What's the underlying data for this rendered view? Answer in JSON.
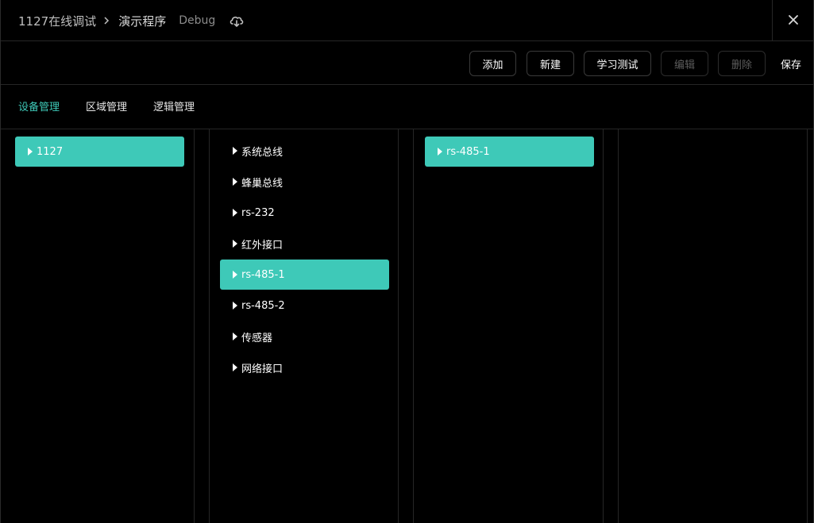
{
  "header": {
    "breadcrumb_root": "1127在线调试",
    "breadcrumb_current": "演示程序",
    "environment": "Debug"
  },
  "toolbar": {
    "add_label": "添加",
    "new_label": "新建",
    "learn_test_label": "学习测试",
    "edit_label": "编辑",
    "delete_label": "删除",
    "save_label": "保存"
  },
  "tabs": [
    {
      "label": "设备管理",
      "active": true
    },
    {
      "label": "区域管理",
      "active": false
    },
    {
      "label": "逻辑管理",
      "active": false
    }
  ],
  "column1": {
    "items": [
      {
        "label": "1127",
        "selected": true
      }
    ]
  },
  "column2": {
    "items": [
      {
        "label": "系统总线",
        "selected": false
      },
      {
        "label": "蜂巢总线",
        "selected": false
      },
      {
        "label": "rs-232",
        "selected": false
      },
      {
        "label": "红外接口",
        "selected": false
      },
      {
        "label": "rs-485-1",
        "selected": true
      },
      {
        "label": "rs-485-2",
        "selected": false
      },
      {
        "label": "传感器",
        "selected": false
      },
      {
        "label": "网络接口",
        "selected": false
      }
    ]
  },
  "column3": {
    "items": [
      {
        "label": "rs-485-1",
        "selected": true
      }
    ]
  },
  "colors": {
    "accent": "#3ec9b8",
    "background": "#000000",
    "border": "#262626"
  }
}
